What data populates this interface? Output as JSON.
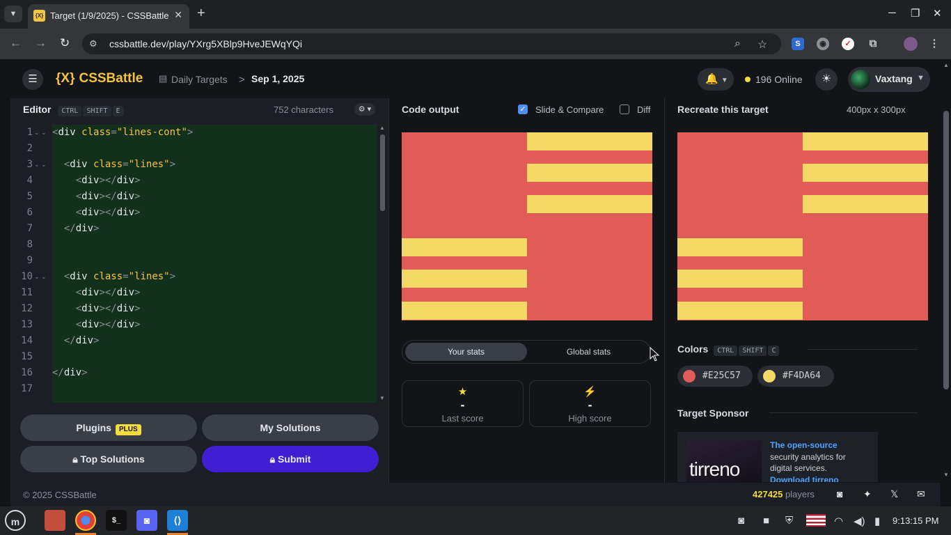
{
  "browser": {
    "tab_title": "Target (1/9/2025) - CSSBattle",
    "favicon": "{X}",
    "url": "cssbattle.dev/play/YXrg5XBlp9HveJEWqYQi"
  },
  "header": {
    "logo_mark": "{X}",
    "logo_text": "CSSBattle",
    "breadcrumb_section": "Daily Targets",
    "breadcrumb_separator": ">",
    "breadcrumb_date": "Sep 1, 2025",
    "online_count": "196 Online",
    "username": "Vaxtang"
  },
  "editor": {
    "title": "Editor",
    "shortcut": [
      "CTRL",
      "SHIFT",
      "E"
    ],
    "char_count": "752 characters",
    "lines": [
      {
        "n": "1",
        "fold": "⌄ ⌄",
        "indent": "",
        "parts": [
          [
            "br",
            "<"
          ],
          [
            "tag",
            "div "
          ],
          [
            "attr",
            "class"
          ],
          [
            "br",
            "="
          ],
          [
            "str",
            "\"lines-cont\""
          ],
          [
            "br",
            ">"
          ]
        ]
      },
      {
        "n": "2",
        "fold": "",
        "indent": "",
        "parts": []
      },
      {
        "n": "3",
        "fold": "⌄ ⌄",
        "indent": "  ",
        "parts": [
          [
            "br",
            "<"
          ],
          [
            "tag",
            "div "
          ],
          [
            "attr",
            "class"
          ],
          [
            "br",
            "="
          ],
          [
            "str",
            "\"lines\""
          ],
          [
            "br",
            ">"
          ]
        ]
      },
      {
        "n": "4",
        "fold": "",
        "indent": "    ",
        "parts": [
          [
            "br",
            "<"
          ],
          [
            "tag",
            "div"
          ],
          [
            "br",
            "></"
          ],
          [
            "tag",
            "div"
          ],
          [
            "br",
            ">"
          ]
        ]
      },
      {
        "n": "5",
        "fold": "",
        "indent": "    ",
        "parts": [
          [
            "br",
            "<"
          ],
          [
            "tag",
            "div"
          ],
          [
            "br",
            "></"
          ],
          [
            "tag",
            "div"
          ],
          [
            "br",
            ">"
          ]
        ]
      },
      {
        "n": "6",
        "fold": "",
        "indent": "    ",
        "parts": [
          [
            "br",
            "<"
          ],
          [
            "tag",
            "div"
          ],
          [
            "br",
            "></"
          ],
          [
            "tag",
            "div"
          ],
          [
            "br",
            ">"
          ]
        ]
      },
      {
        "n": "7",
        "fold": "",
        "indent": "  ",
        "parts": [
          [
            "br",
            "</"
          ],
          [
            "tag",
            "div"
          ],
          [
            "br",
            ">"
          ]
        ]
      },
      {
        "n": "8",
        "fold": "",
        "indent": "",
        "parts": []
      },
      {
        "n": "9",
        "fold": "",
        "indent": "",
        "parts": []
      },
      {
        "n": "10",
        "fold": "⌄ ⌄",
        "indent": "  ",
        "parts": [
          [
            "br",
            "<"
          ],
          [
            "tag",
            "div "
          ],
          [
            "attr",
            "class"
          ],
          [
            "br",
            "="
          ],
          [
            "str",
            "\"lines\""
          ],
          [
            "br",
            ">"
          ]
        ]
      },
      {
        "n": "11",
        "fold": "",
        "indent": "    ",
        "parts": [
          [
            "br",
            "<"
          ],
          [
            "tag",
            "div"
          ],
          [
            "br",
            "></"
          ],
          [
            "tag",
            "div"
          ],
          [
            "br",
            ">"
          ]
        ]
      },
      {
        "n": "12",
        "fold": "",
        "indent": "    ",
        "parts": [
          [
            "br",
            "<"
          ],
          [
            "tag",
            "div"
          ],
          [
            "br",
            "></"
          ],
          [
            "tag",
            "div"
          ],
          [
            "br",
            ">"
          ]
        ]
      },
      {
        "n": "13",
        "fold": "",
        "indent": "    ",
        "parts": [
          [
            "br",
            "<"
          ],
          [
            "tag",
            "div"
          ],
          [
            "br",
            "></"
          ],
          [
            "tag",
            "div"
          ],
          [
            "br",
            ">"
          ]
        ]
      },
      {
        "n": "14",
        "fold": "",
        "indent": "  ",
        "parts": [
          [
            "br",
            "</"
          ],
          [
            "tag",
            "div"
          ],
          [
            "br",
            ">"
          ]
        ]
      },
      {
        "n": "15",
        "fold": "",
        "indent": "",
        "parts": []
      },
      {
        "n": "16",
        "fold": "",
        "indent": "",
        "parts": [
          [
            "br",
            "</"
          ],
          [
            "tag",
            "div"
          ],
          [
            "br",
            ">"
          ]
        ]
      },
      {
        "n": "17",
        "fold": "",
        "indent": "",
        "parts": []
      }
    ],
    "buttons": {
      "plugins": "Plugins",
      "plus_badge": "PLUS",
      "my_solutions": "My Solutions",
      "top_solutions": "Top Solutions",
      "submit": "Submit"
    }
  },
  "output": {
    "title": "Code output",
    "slide_compare_label": "Slide & Compare",
    "slide_compare_checked": true,
    "diff_label": "Diff",
    "diff_checked": false,
    "stats_tab_active": "Your stats",
    "stats_tab_other": "Global stats",
    "last_score_value": "-",
    "last_score_label": "Last score",
    "high_score_value": "-",
    "high_score_label": "High score"
  },
  "target": {
    "title": "Recreate this target",
    "size": "400px x 300px",
    "colors_title": "Colors",
    "colors_shortcut": [
      "CTRL",
      "SHIFT",
      "C"
    ],
    "colors": [
      "#E25C57",
      "#F4DA64"
    ],
    "sponsor_title": "Target Sponsor",
    "sponsor_logo": "tirreno",
    "sponsor_link": "The open-source",
    "sponsor_text_1": "security analytics for",
    "sponsor_text_2": "digital services.",
    "sponsor_cta": "Download tirreno"
  },
  "footer": {
    "copyright": "© 2025 CSSBattle",
    "player_count": "427425",
    "players_label": "players"
  },
  "taskbar": {
    "clock": "9:13:15 PM"
  }
}
